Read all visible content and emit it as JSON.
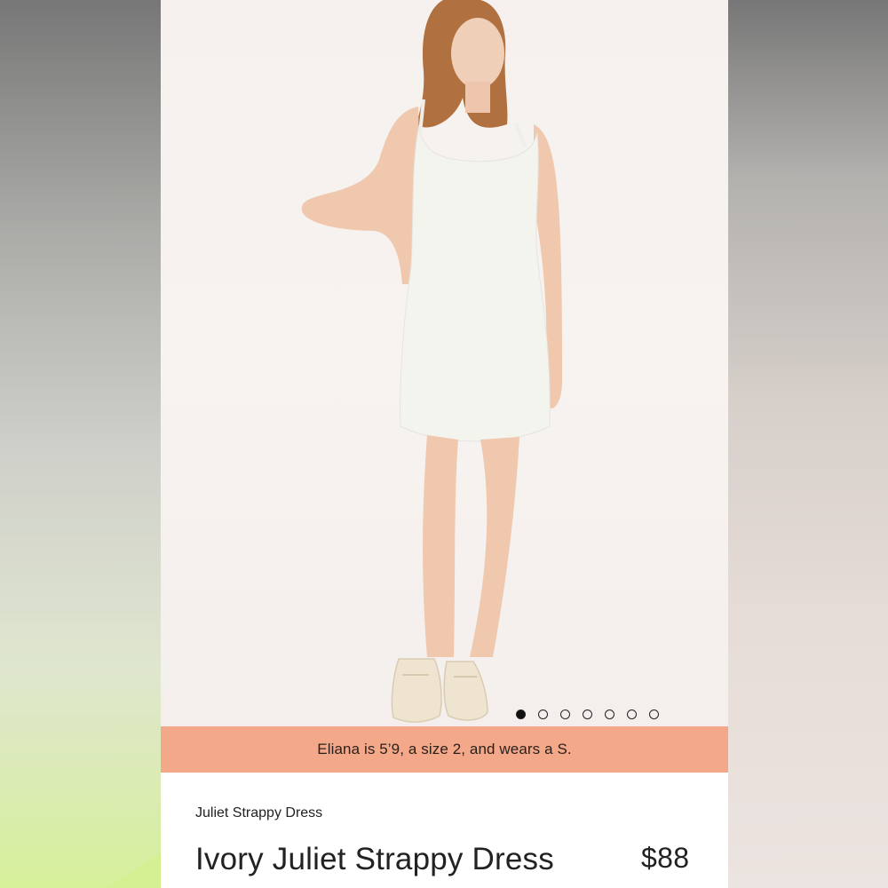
{
  "carousel": {
    "total_slides": 7,
    "active_index": 0
  },
  "size_note": "Eliana is 5’9, a size 2, and wears a S.",
  "product": {
    "collection_name": "Juliet Strappy Dress",
    "title": "Ivory Juliet Strappy Dress",
    "price": "$88"
  },
  "colors": {
    "banner": "#f3a88a",
    "dress": "#f4f4ef",
    "background": "#f6f1ee"
  }
}
